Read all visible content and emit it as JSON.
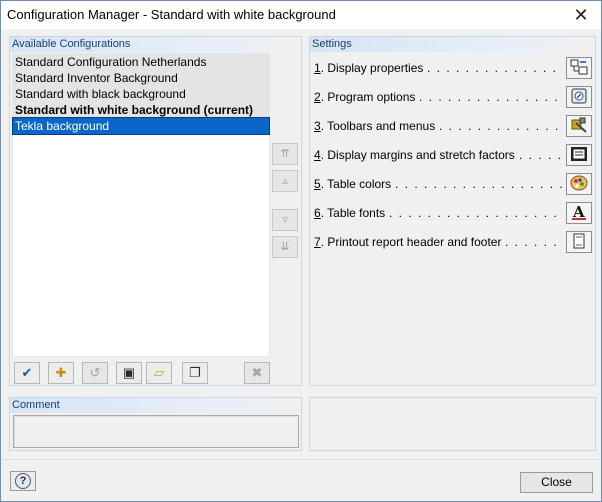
{
  "window": {
    "title": "Configuration Manager - Standard with white background",
    "close_glyph": "✕"
  },
  "available": {
    "header": "Available Configurations",
    "items": [
      {
        "label": "Standard Configuration Netherlands",
        "style": "normal"
      },
      {
        "label": "Standard Inventor Background",
        "style": "normal"
      },
      {
        "label": "Standard with black background",
        "style": "normal"
      },
      {
        "label": "Standard with white background (current)",
        "style": "bold"
      },
      {
        "label": "Tekla background",
        "style": "selected"
      }
    ],
    "side_buttons": [
      {
        "name": "move-top-icon",
        "glyph": "⇈"
      },
      {
        "name": "move-up-icon",
        "glyph": "▵"
      },
      {
        "name": "move-down-icon",
        "glyph": "▿"
      },
      {
        "name": "move-bottom-icon",
        "glyph": "⇊"
      }
    ],
    "toolbar": [
      {
        "name": "apply-checkmark-icon",
        "glyph": "✔",
        "enabled": true,
        "color": "#1a56b0"
      },
      {
        "name": "new-configuration-icon",
        "glyph": "✚",
        "enabled": true,
        "color": "#c98a1a"
      },
      {
        "name": "rename-icon",
        "glyph": "↺",
        "enabled": false,
        "color": "#a5a5a5"
      },
      {
        "name": "save-icon",
        "glyph": "▣",
        "enabled": true,
        "color": "#2a2a2a"
      },
      {
        "name": "open-folder-icon",
        "glyph": "▱",
        "enabled": true,
        "color": "#c9a227"
      },
      {
        "name": "copy-icon",
        "glyph": "❐",
        "enabled": true,
        "color": "#2a2a2a"
      },
      {
        "name": "delete-icon",
        "glyph": "✖",
        "enabled": false,
        "color": "#a5a5a5"
      }
    ]
  },
  "settings": {
    "header": "Settings",
    "rows": [
      {
        "num": "1",
        "label": ". Display properties",
        "icon": "display-properties-icon"
      },
      {
        "num": "2",
        "label": ". Program options",
        "icon": "program-options-icon"
      },
      {
        "num": "3",
        "label": ". Toolbars and menus",
        "icon": "toolbars-menus-icon"
      },
      {
        "num": "4",
        "label": ". Display margins and stretch factors",
        "icon": "display-margins-icon"
      },
      {
        "num": "5",
        "label": ". Table colors",
        "icon": "table-colors-icon"
      },
      {
        "num": "6",
        "label": ". Table fonts",
        "icon": "table-fonts-icon"
      },
      {
        "num": "7",
        "label": ". Printout report header and footer",
        "icon": "printout-report-icon"
      }
    ]
  },
  "comment": {
    "header": "Comment",
    "value": ""
  },
  "footer": {
    "help_glyph": "?",
    "close_label": "Close"
  }
}
